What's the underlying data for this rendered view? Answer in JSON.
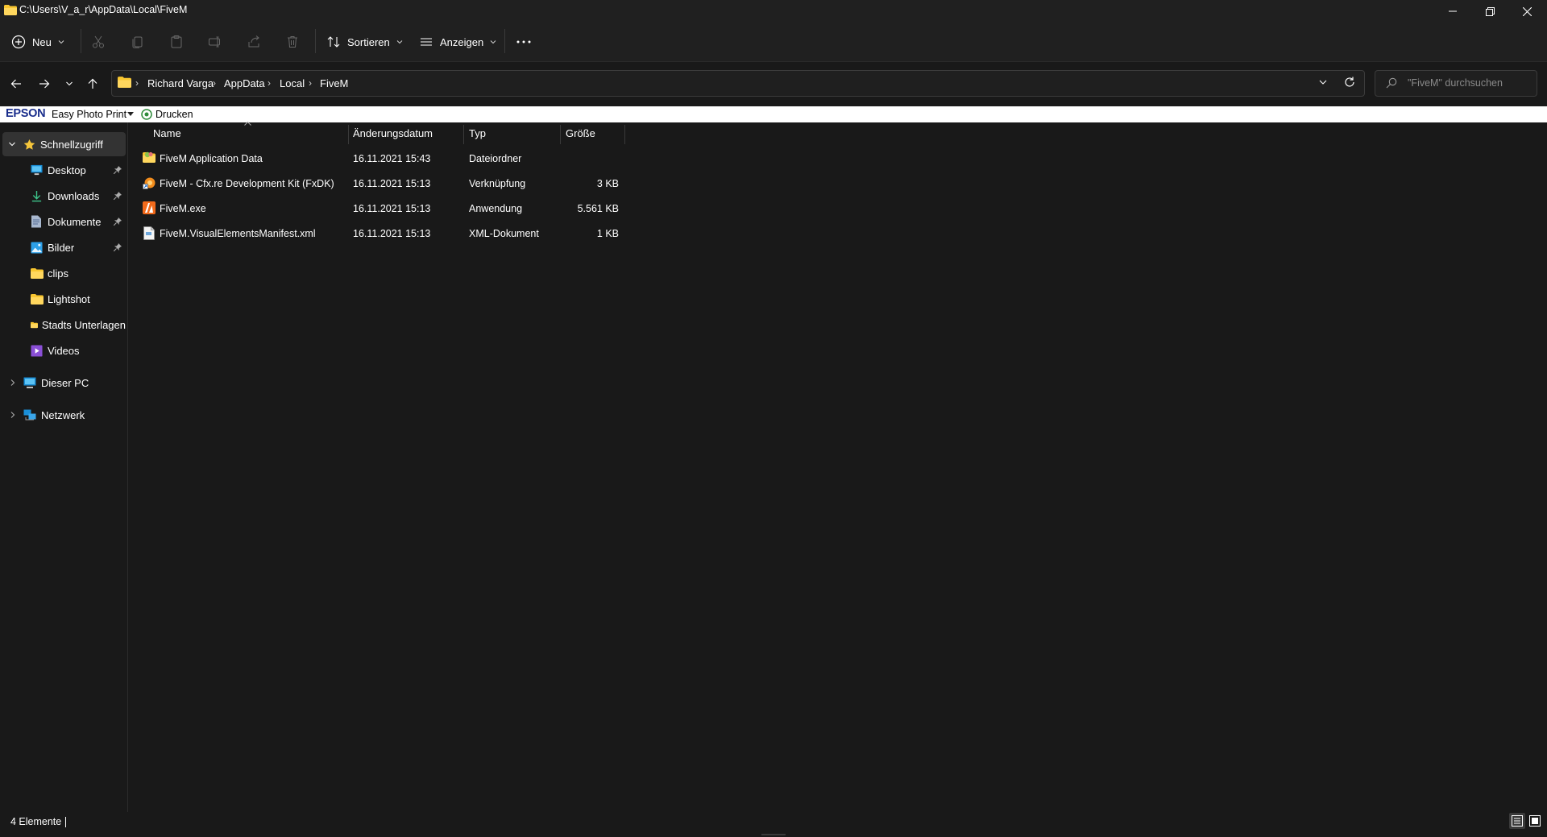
{
  "window": {
    "title": "C:\\Users\\V_a_r\\AppData\\Local\\FiveM",
    "controls": [
      "minimize",
      "maximize",
      "close"
    ]
  },
  "toolbar": {
    "new_label": "Neu",
    "sort_label": "Sortieren",
    "view_label": "Anzeigen",
    "disabled_actions": [
      "cut",
      "copy",
      "paste",
      "rename",
      "share",
      "delete"
    ]
  },
  "address": {
    "crumbs": [
      "Richard Varga",
      "AppData",
      "Local",
      "FiveM"
    ],
    "search_placeholder": "\"FiveM\" durchsuchen"
  },
  "epson": {
    "brand": "EPSON",
    "product": "Easy Photo Print",
    "print_label": "Drucken"
  },
  "sidebar": {
    "quick_access": "Schnellzugriff",
    "items": [
      {
        "label": "Desktop",
        "icon": "desktop-icon",
        "pinned": true
      },
      {
        "label": "Downloads",
        "icon": "download-icon",
        "pinned": true
      },
      {
        "label": "Dokumente",
        "icon": "document-icon",
        "pinned": true
      },
      {
        "label": "Bilder",
        "icon": "pictures-icon",
        "pinned": true
      },
      {
        "label": "clips",
        "icon": "folder-icon",
        "pinned": false
      },
      {
        "label": "Lightshot",
        "icon": "folder-icon",
        "pinned": false
      },
      {
        "label": "Stadts Unterlagen",
        "icon": "folder-icon",
        "pinned": true
      },
      {
        "label": "Videos",
        "icon": "videos-icon",
        "pinned": false
      }
    ],
    "this_pc": "Dieser PC",
    "network": "Netzwerk"
  },
  "columns": {
    "name": "Name",
    "date": "Änderungsdatum",
    "type": "Typ",
    "size": "Größe"
  },
  "files": [
    {
      "name": "FiveM Application Data",
      "date": "16.11.2021 15:43",
      "type": "Dateiordner",
      "size": "",
      "icon": "fivem-folder-icon"
    },
    {
      "name": "FiveM - Cfx.re Development Kit (FxDK)",
      "date": "16.11.2021 15:13",
      "type": "Verknüpfung",
      "size": "3 KB",
      "icon": "shortcut-icon"
    },
    {
      "name": "FiveM.exe",
      "date": "16.11.2021 15:13",
      "type": "Anwendung",
      "size": "5.561 KB",
      "icon": "fivem-exe-icon"
    },
    {
      "name": "FiveM.VisualElementsManifest.xml",
      "date": "16.11.2021 15:13",
      "type": "XML-Dokument",
      "size": "1 KB",
      "icon": "xml-file-icon"
    }
  ],
  "status": {
    "count": "4 Elemente"
  },
  "colors": {
    "background": "#191919",
    "chrome": "#202020",
    "selection": "#333333",
    "folder": "#f8c630",
    "fivem_orange": "#f40"
  }
}
